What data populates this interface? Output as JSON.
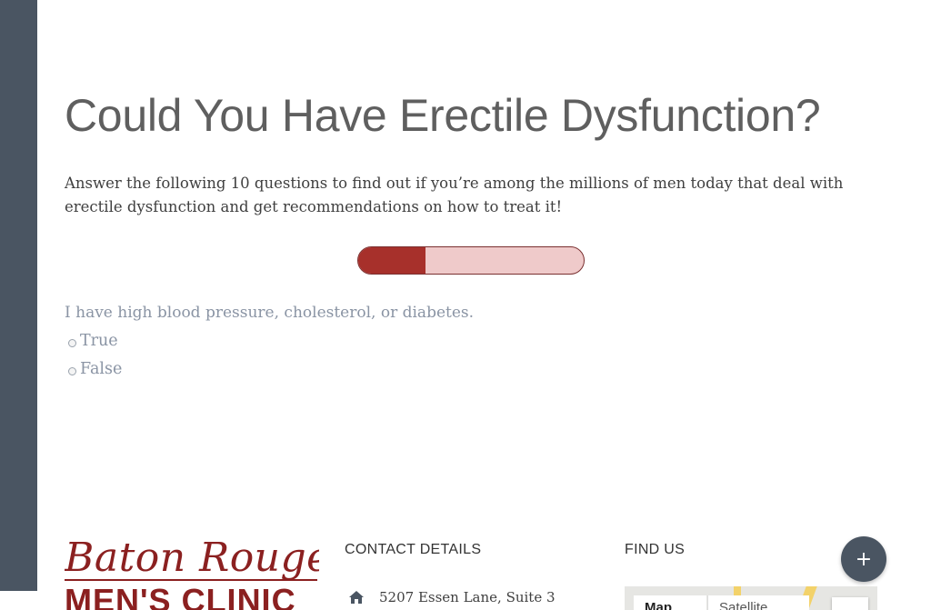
{
  "quiz": {
    "title": "Could You Have Erectile Dysfunction?",
    "intro": "Answer the following 10 questions to find out if you’re among the millions of men today that deal with erectile dysfunction and get recommendations on how to treat it!",
    "progress_fraction": 0.3,
    "question": "I have high blood pressure, cholesterol, or diabetes.",
    "options": [
      "True",
      "False"
    ]
  },
  "footer": {
    "logo": {
      "script": "Baton Rouge",
      "bold": "MEN'S CLINIC"
    },
    "contact_heading": "CONTACT DETAILS",
    "address": "5207 Essen Lane, Suite 3",
    "find_heading": "FIND US",
    "map": {
      "map_tab": "Map",
      "satellite_tab": "Satellite"
    }
  },
  "fab": {
    "icon": "plus-icon",
    "label": "+"
  },
  "colors": {
    "sidebar": "#4a5562",
    "progress_fill": "#a7302b",
    "progress_track": "#efcaca",
    "brand": "#8b2020",
    "question_text": "#8a94a4"
  }
}
